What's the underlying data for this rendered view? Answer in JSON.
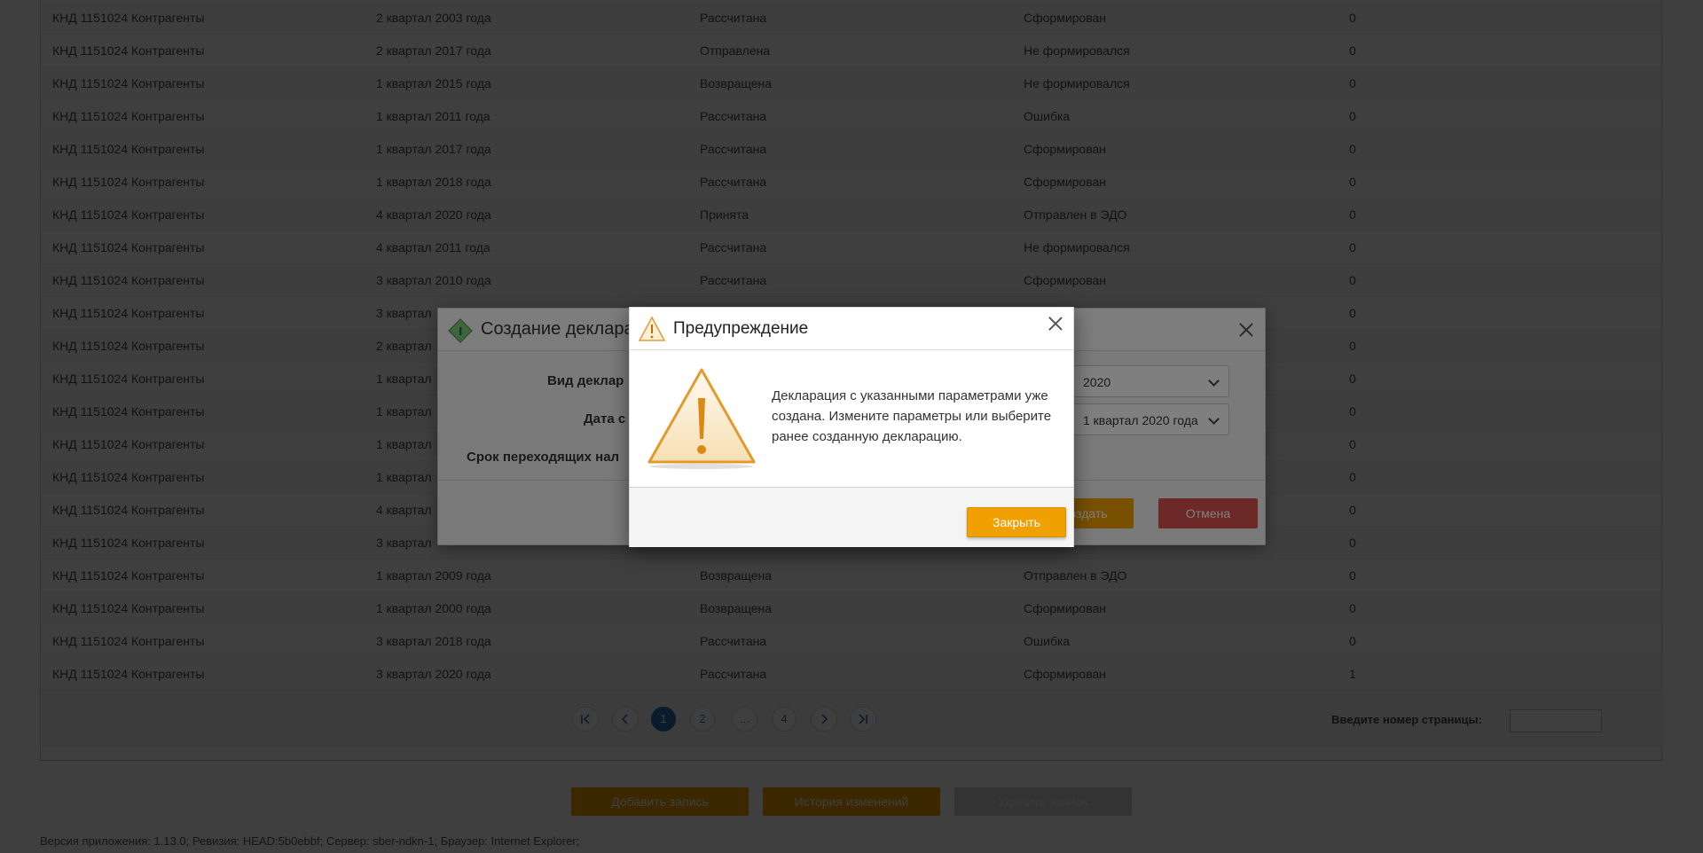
{
  "table": {
    "rows": [
      [
        "КНД 1151024 Контрагенты",
        "2 квартал 2003 года",
        "Рассчитана",
        "Сформирован",
        "0"
      ],
      [
        "КНД 1151024 Контрагенты",
        "2 квартал 2017 года",
        "Отправлена",
        "Не формировался",
        "0"
      ],
      [
        "КНД 1151024 Контрагенты",
        "1 квартал 2015 года",
        "Возвращена",
        "Не формировался",
        "0"
      ],
      [
        "КНД 1151024 Контрагенты",
        "1 квартал 2011 года",
        "Рассчитана",
        "Ошибка",
        "0"
      ],
      [
        "КНД 1151024 Контрагенты",
        "1 квартал 2017 года",
        "Рассчитана",
        "Сформирован",
        "0"
      ],
      [
        "КНД 1151024 Контрагенты",
        "1 квартал 2018 года",
        "Рассчитана",
        "Сформирован",
        "0"
      ],
      [
        "КНД 1151024 Контрагенты",
        "4 квартал 2020 года",
        "Принята",
        "Отправлен в ЭДО",
        "0"
      ],
      [
        "КНД 1151024 Контрагенты",
        "4 квартал 2011 года",
        "Рассчитана",
        "Не формировался",
        "0"
      ],
      [
        "КНД 1151024 Контрагенты",
        "3 квартал 2010 года",
        "Рассчитана",
        "Сформирован",
        "0"
      ],
      [
        "КНД 1151024 Контрагенты",
        "3 квартал",
        "",
        "",
        "0"
      ],
      [
        "КНД 1151024 Контрагенты",
        "2 квартал",
        "",
        "",
        "0"
      ],
      [
        "КНД 1151024 Контрагенты",
        "1 квартал",
        "",
        "",
        "0"
      ],
      [
        "КНД 1151024 Контрагенты",
        "1 квартал",
        "",
        "",
        "0"
      ],
      [
        "КНД 1151024 Контрагенты",
        "1 квартал",
        "",
        "",
        "0"
      ],
      [
        "КНД 1151024 Контрагенты",
        "1 квартал",
        "",
        "",
        "0"
      ],
      [
        "КНД 1151024 Контрагенты",
        "4 квартал",
        "",
        "",
        "0"
      ],
      [
        "КНД 1151024 Контрагенты",
        "3 квартал",
        "",
        "",
        "0"
      ],
      [
        "КНД 1151024 Контрагенты",
        "1 квартал 2009 года",
        "Возвращена",
        "Отправлен в ЭДО",
        "0"
      ],
      [
        "КНД 1151024 Контрагенты",
        "1 квартал 2000 года",
        "Возвращена",
        "Сформирован",
        "0"
      ],
      [
        "КНД 1151024 Контрагенты",
        "3 квартал 2018 года",
        "Рассчитана",
        "Ошибка",
        "0"
      ],
      [
        "КНД 1151024 Контрагенты",
        "3 квартал 2020 года",
        "Рассчитана",
        "Сформирован",
        "1"
      ]
    ]
  },
  "pager": {
    "first_icon": "first-page-icon",
    "prev_icon": "prev-page-icon",
    "pages": [
      "1",
      "2",
      "...",
      "4"
    ],
    "next_icon": "next-page-icon",
    "last_icon": "last-page-icon",
    "goto_label": "Введите номер страницы:",
    "goto_value": ""
  },
  "actions": {
    "add": "Добавить запись",
    "history": "История изменений",
    "delete": "Удалить запись"
  },
  "footer": "Версия приложения: 1.13.0; Ревизия: HEAD:5b0ebbf; Сервер: sber-ndkn-1; Браузер: Internet Explorer;",
  "create_dialog": {
    "title": "Создание деклара",
    "label_type": "Вид деклар",
    "label_date": "Дата с",
    "label_term": "Срок переходящих нал",
    "year_value": "2020",
    "period_value": "1 квартал 2020 года",
    "create_button": "Создать",
    "cancel_button": "Отмена"
  },
  "warning_dialog": {
    "title": "Предупреждение",
    "message": "Декларация с указанными параметрами уже создана. Измените параметры или выберите ранее созданную декларацию.",
    "close_button": "Закрыть"
  },
  "colors": {
    "accent_orange": "#f0a000",
    "cancel_red": "#d9534f",
    "pager_blue": "#2a6ebb"
  }
}
